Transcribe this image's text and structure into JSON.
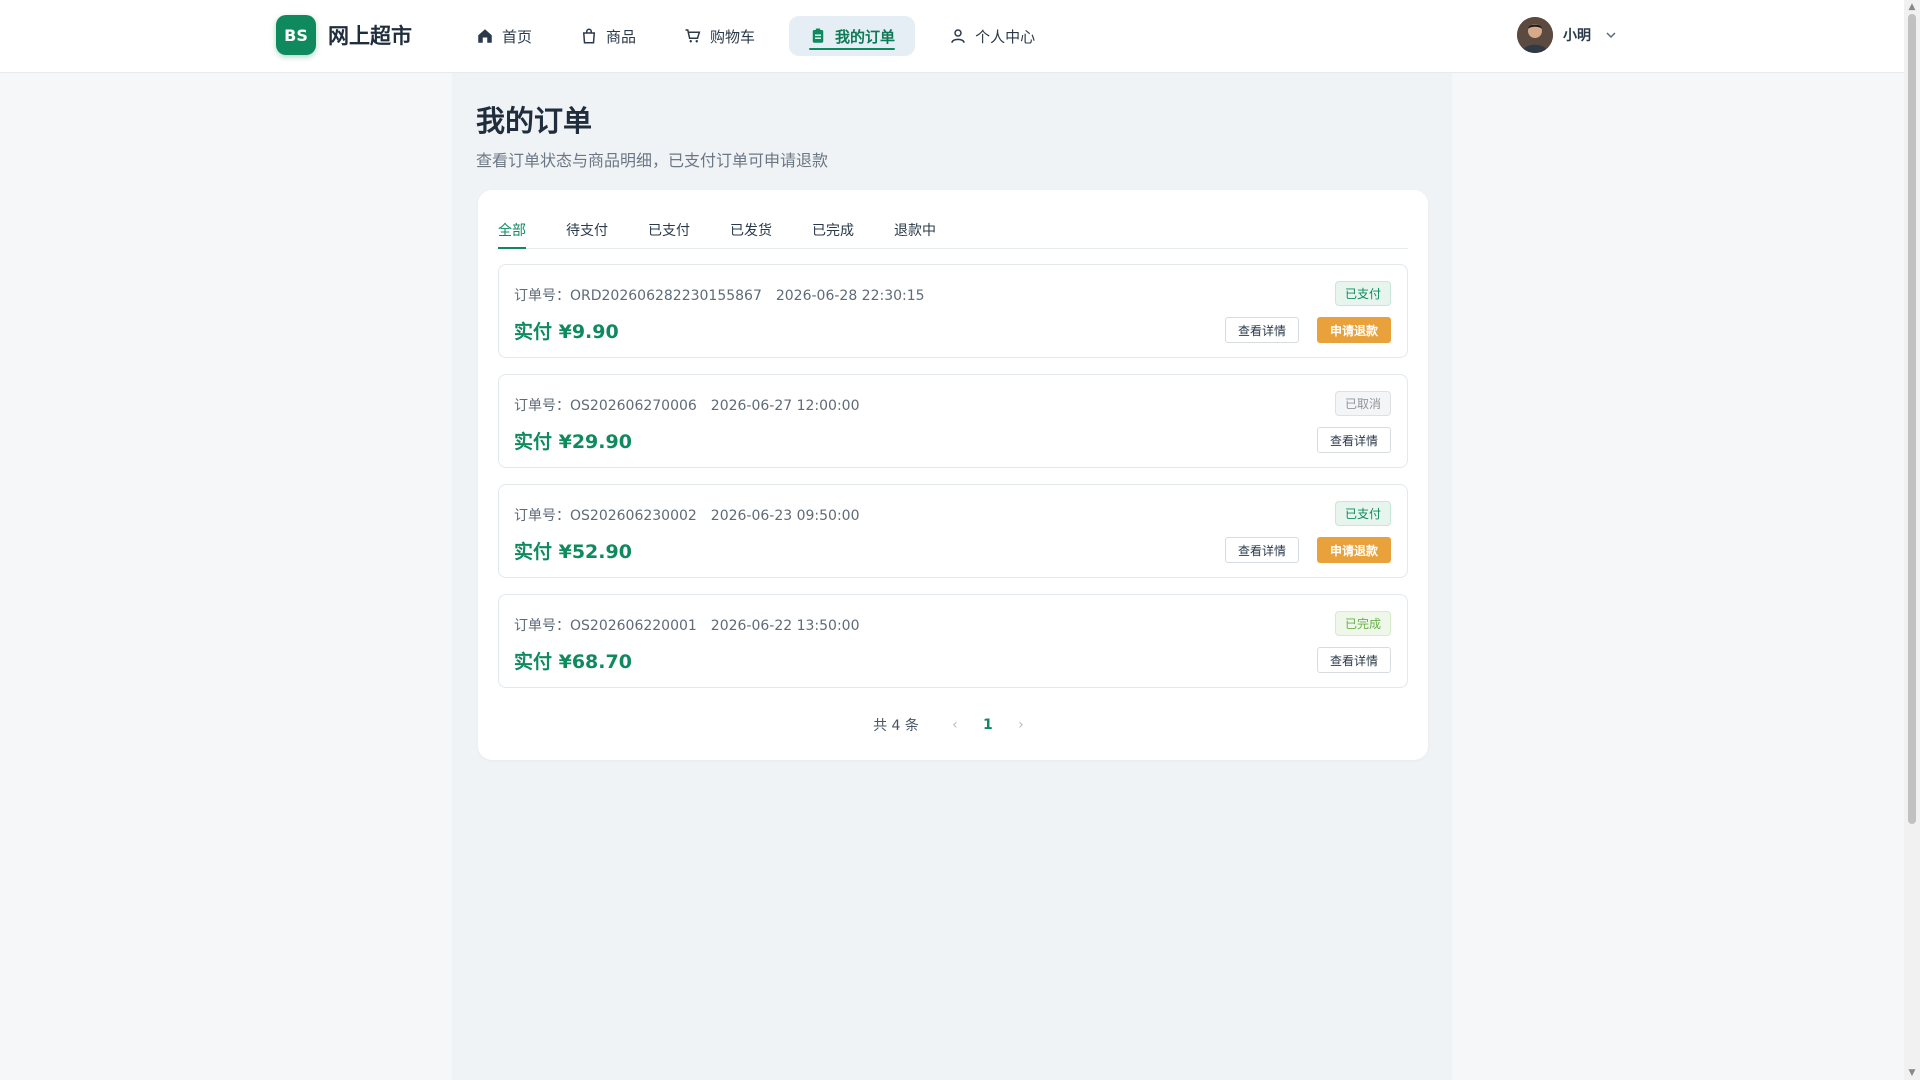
{
  "brand": {
    "badge": "BS",
    "name": "网上超市"
  },
  "nav": {
    "items": [
      {
        "label": "首页",
        "icon": "home-icon"
      },
      {
        "label": "商品",
        "icon": "bag-icon"
      },
      {
        "label": "购物车",
        "icon": "cart-icon"
      },
      {
        "label": "我的订单",
        "icon": "clipboard-icon",
        "active": true
      },
      {
        "label": "个人中心",
        "icon": "user-icon"
      }
    ]
  },
  "user": {
    "name": "小明"
  },
  "page": {
    "title": "我的订单",
    "subtitle": "查看订单状态与商品明细，已支付订单可申请退款"
  },
  "tabs": [
    "全部",
    "待支付",
    "已支付",
    "已发货",
    "已完成",
    "退款中"
  ],
  "active_tab": "全部",
  "orders": [
    {
      "no_label": "订单号：",
      "no": "ORD202606282230155867",
      "date": "2026-06-28 22:30:15",
      "status": "已支付",
      "price": "实付 ¥9.90",
      "detail": "查看详情",
      "refund": "申请退款"
    },
    {
      "no_label": "订单号：",
      "no": "OS202606270006",
      "date": "2026-06-27 12:00:00",
      "status": "已取消",
      "price": "实付 ¥29.90",
      "detail": "查看详情"
    },
    {
      "no_label": "订单号：",
      "no": "OS202606230002",
      "date": "2026-06-23 09:50:00",
      "status": "已支付",
      "price": "实付 ¥52.90",
      "detail": "查看详情",
      "refund": "申请退款"
    },
    {
      "no_label": "订单号：",
      "no": "OS202606220001",
      "date": "2026-06-22 13:50:00",
      "status": "已完成",
      "price": "实付 ¥68.70",
      "detail": "查看详情"
    }
  ],
  "pagination": {
    "total": "共 4 条",
    "current": "1"
  },
  "colors": {
    "brand": "#0f8a5f",
    "refund": "#e9a13b",
    "page_bg": "#f5f7f8"
  }
}
